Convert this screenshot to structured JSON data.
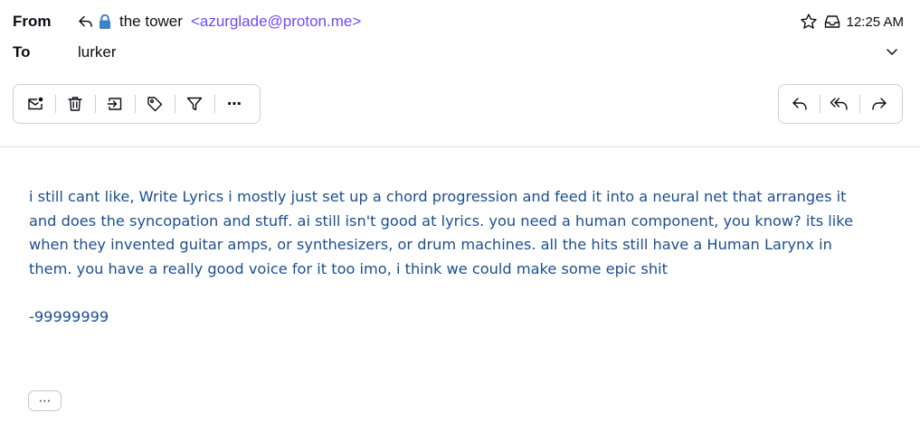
{
  "header": {
    "from_label": "From",
    "to_label": "To",
    "sender_name": "the tower",
    "sender_address": "<azurglade@proton.me>",
    "recipient": "lurker",
    "time": "12:25 AM"
  },
  "icons": {
    "reply_arrow": "reply-icon",
    "lock": "lock-icon",
    "star": "star-icon",
    "inbox": "inbox-icon",
    "expand": "chevron-down-icon"
  },
  "toolbar": {
    "left": [
      "mark-unread",
      "trash",
      "move-to",
      "label",
      "filter",
      "more"
    ],
    "right": [
      "reply",
      "reply-all",
      "forward"
    ],
    "more_label": "⋯"
  },
  "message": {
    "paragraph": "i still cant like, Write Lyrics i mostly just set up a chord progression and feed it into a neural net that arranges it and does the syncopation and stuff. ai still isn't good at lyrics. you need a human component, you know? its like when they invented guitar amps, or synthesizers, or drum machines. all the hits still have a Human Larynx in them. you have a really good voice for it too imo, i think we could make some epic shit",
    "signature": "-99999999",
    "show_more_label": "⋯"
  },
  "colors": {
    "accent": "#6d4aff",
    "lock": "#3d82c4",
    "body_text": "#1c4f8e"
  }
}
